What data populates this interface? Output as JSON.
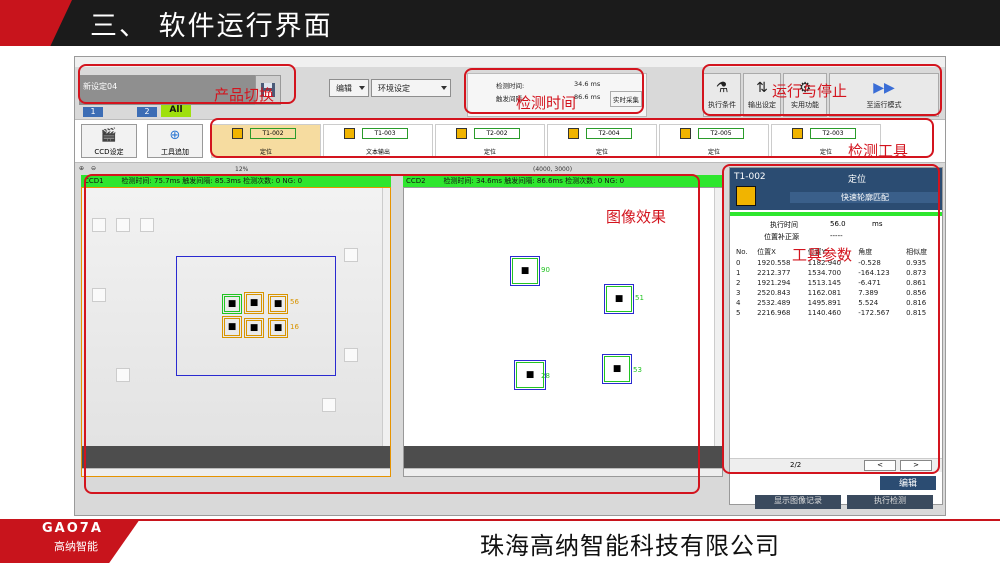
{
  "slide": {
    "title": "三、 软件运行界面",
    "company": "珠海高纳智能科技有限公司",
    "logo_text": "GAO7A",
    "logo_sub": "高纳智能"
  },
  "app": {
    "product_field": "新设定04",
    "group_tabs": [
      "1",
      "2"
    ],
    "all_tab": "All",
    "dropdown_edit": "编辑",
    "dropdown_env": "环境设定",
    "detect_time_label": "检测时间:",
    "detect_time_value": "34.6 ms",
    "trigger_interval_label": "触发间隔:",
    "trigger_interval_value": "86.6 ms",
    "realtime_btn": "实时采集",
    "toolbar_buttons": [
      "执行条件",
      "输出设定",
      "实用功能",
      "至运行模式"
    ],
    "left_buttons": [
      "CCD设定",
      "工具追加"
    ],
    "tools": [
      {
        "name": "T1-002",
        "sub": "定位"
      },
      {
        "name": "T1-003",
        "sub": "文本输出"
      },
      {
        "name": "T2-002",
        "sub": "定位"
      },
      {
        "name": "T2-004",
        "sub": "定位"
      },
      {
        "name": "T2-005",
        "sub": "定位"
      },
      {
        "name": "T2-003",
        "sub": "定位"
      }
    ],
    "zoom": "12%",
    "coord": "(4000, 3000)",
    "ccd1": {
      "name": "CCD1",
      "stats": "检测时间:  75.7ms  触发间隔:  85.3ms  检测次数:  0  NG: 0",
      "labels": [
        "56",
        "16"
      ]
    },
    "ccd2": {
      "name": "CCD2",
      "stats": "检测时间:  34.6ms  触发间隔:  86.6ms  检测次数:  0  NG: 0",
      "labels": [
        "90",
        "51",
        "28",
        "53"
      ]
    },
    "panel": {
      "tool_id": "T1-002",
      "tool_type": "定位",
      "method": "快速轮廓匹配",
      "exec_time_label": "执行时间",
      "exec_time_value": "56.0",
      "exec_time_unit": "ms",
      "pos_comp_label": "位置补正源",
      "pos_comp_value": "-----",
      "columns": [
        "No.",
        "位置X",
        "位置Y",
        "角度",
        "相似度"
      ],
      "rows": [
        [
          "0",
          "1920.558",
          "1182.940",
          "-0.528",
          "0.935"
        ],
        [
          "1",
          "2212.377",
          "1534.700",
          "-164.123",
          "0.873"
        ],
        [
          "2",
          "1921.294",
          "1513.145",
          "-6.471",
          "0.861"
        ],
        [
          "3",
          "2520.843",
          "1162.081",
          "7.389",
          "0.856"
        ],
        [
          "4",
          "2532.489",
          "1495.891",
          "5.524",
          "0.816"
        ],
        [
          "5",
          "2216.968",
          "1140.460",
          "-172.567",
          "0.815"
        ]
      ],
      "page": "2/2",
      "prev": "<",
      "next": ">",
      "edit": "编辑"
    },
    "bottom_buttons": [
      "显示图像记录",
      "执行检测"
    ]
  },
  "annotations": [
    "产品切换",
    "检测时间",
    "运行与停止",
    "检测工具",
    "图像效果",
    "工具参数"
  ],
  "colors": {
    "annotation": "#d3141e",
    "header_green": "#2ee62e",
    "brand_red": "#c8141c"
  }
}
